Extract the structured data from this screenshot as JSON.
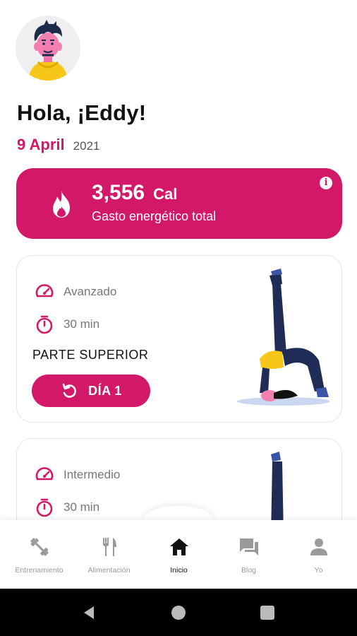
{
  "greeting": "Hola, ¡Eddy!",
  "date": {
    "day_month": "9 April",
    "year": "2021"
  },
  "energy": {
    "value": "3,556",
    "unit": "Cal",
    "label": "Gasto energético total"
  },
  "workouts": [
    {
      "level": "Avanzado",
      "duration": "30 min",
      "title": "PARTE SUPERIOR",
      "button_label": "DÍA 1"
    },
    {
      "level": "Intermedio",
      "duration": "30 min"
    }
  ],
  "nav": {
    "items": [
      {
        "label": "Entrenamiento",
        "icon": "dumbbell-icon",
        "active": false
      },
      {
        "label": "Alimentación",
        "icon": "fork-knife-icon",
        "active": false
      },
      {
        "label": "Inicio",
        "icon": "home-icon",
        "active": true
      },
      {
        "label": "Blog",
        "icon": "chat-icon",
        "active": false
      },
      {
        "label": "Yo",
        "icon": "person-icon",
        "active": false
      }
    ]
  },
  "colors": {
    "accent": "#d3186a",
    "text": "#111111",
    "muted": "#999999",
    "card_border": "#e6e6ea"
  }
}
